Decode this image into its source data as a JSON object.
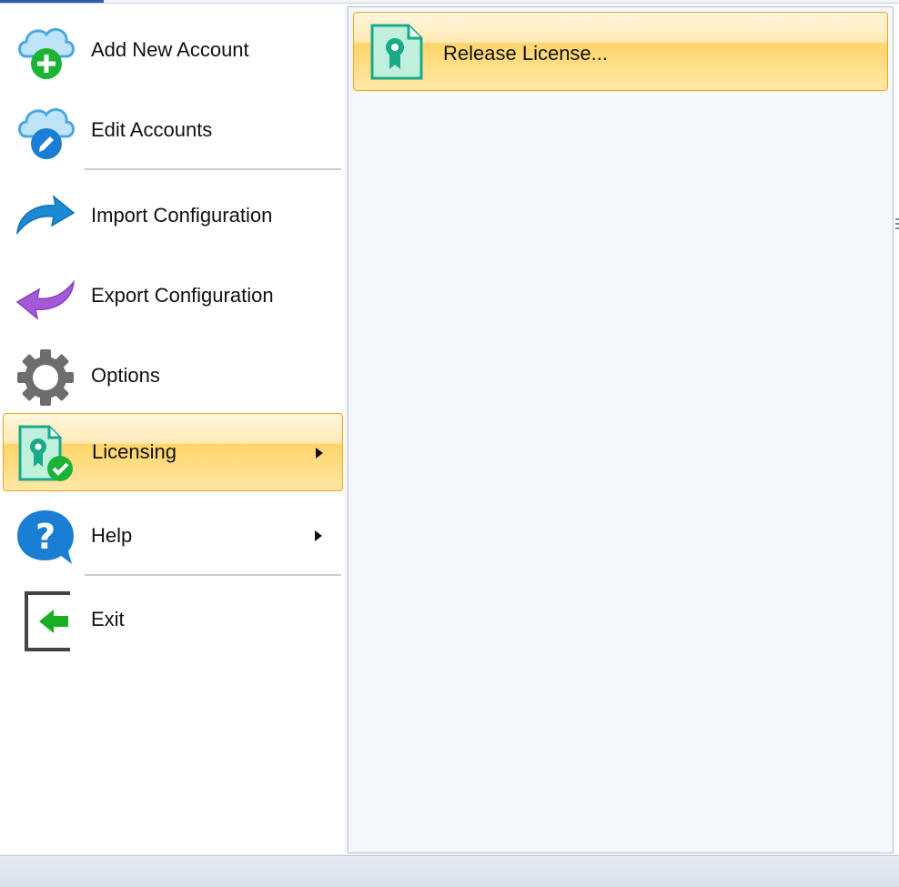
{
  "menu": {
    "items": [
      {
        "id": "add-new-account",
        "label": "Add New Account",
        "icon": "cloud-add-icon"
      },
      {
        "id": "edit-accounts",
        "label": "Edit Accounts",
        "icon": "cloud-edit-icon"
      },
      {
        "id": "import-configuration",
        "label": "Import Configuration",
        "icon": "import-arrow-icon"
      },
      {
        "id": "export-configuration",
        "label": "Export Configuration",
        "icon": "export-arrow-icon"
      },
      {
        "id": "options",
        "label": "Options",
        "icon": "gear-icon"
      },
      {
        "id": "licensing",
        "label": "Licensing",
        "icon": "license-check-icon",
        "selected": true,
        "has_submenu": true
      },
      {
        "id": "help",
        "label": "Help",
        "icon": "help-bubble-icon",
        "has_submenu": true
      },
      {
        "id": "exit",
        "label": "Exit",
        "icon": "exit-icon"
      }
    ]
  },
  "submenu": {
    "items": [
      {
        "id": "release-license",
        "label": "Release License...",
        "icon": "license-certificate-icon",
        "highlighted": true
      }
    ]
  },
  "colors": {
    "highlight_border": "#e8a818",
    "highlight_top": "#fff6df",
    "highlight_bottom": "#ffd56a",
    "cloud_blue": "#4aa8e0",
    "add_green": "#1db336",
    "import_blue": "#1a8ad4",
    "export_purple": "#a45ad6",
    "license_teal": "#1aaa8a",
    "help_blue": "#1a7fd4",
    "exit_green": "#18b020"
  }
}
